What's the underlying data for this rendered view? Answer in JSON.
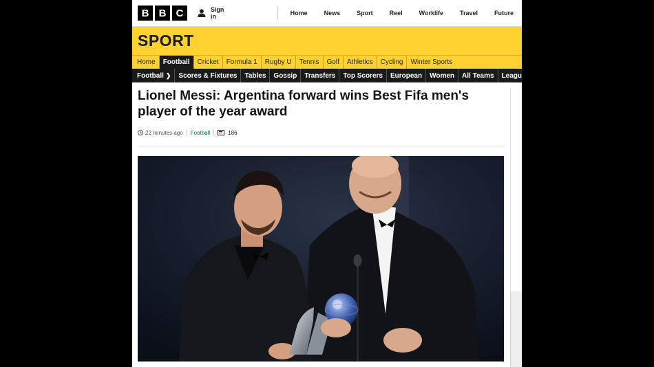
{
  "global_nav": {
    "logo_letters": [
      "B",
      "B",
      "C"
    ],
    "signin_label": "Sign in",
    "links": [
      "Home",
      "News",
      "Sport",
      "Reel",
      "Worklife",
      "Travel",
      "Future"
    ]
  },
  "sport": {
    "title": "SPORT",
    "nav": [
      "Home",
      "Football",
      "Cricket",
      "Formula 1",
      "Rugby U",
      "Tennis",
      "Golf",
      "Athletics",
      "Cycling",
      "Winter Sports"
    ],
    "active": "Football"
  },
  "football_nav": {
    "items": [
      "Football",
      "Scores & Fixtures",
      "Tables",
      "Gossip",
      "Transfers",
      "Top Scorers",
      "European",
      "Women",
      "All Teams",
      "Leagues & Cups"
    ]
  },
  "article": {
    "headline": "Lionel Messi: Argentina forward wins Best Fifa men's player of the year award",
    "timestamp": "22 minutes ago",
    "section": "Football",
    "comment_count": "186"
  },
  "colors": {
    "sport_yellow": "#ffd230",
    "nav_dark": "#1a1a1a",
    "link_green": "#0a6e3e"
  },
  "icons": [
    "user-icon",
    "clock-icon",
    "comment-icon"
  ]
}
